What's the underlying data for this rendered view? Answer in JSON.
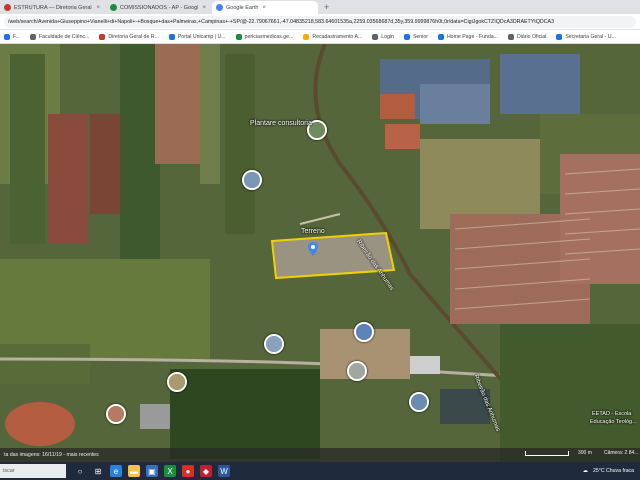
{
  "browser": {
    "tabs": [
      {
        "label": "ESTRUTURA — Diretoria Geral do...",
        "favicon_color": "#c0392b"
      },
      {
        "label": "COMISSIONADOS - AP - Googl...",
        "favicon_color": "#1e8e3e"
      },
      {
        "label": "Google Earth",
        "favicon_color": "#4285f4",
        "active": true
      }
    ],
    "new_tab": "+",
    "close": "×",
    "url": "/web/search/Avenida+Giuseppino+Vianelli+di+Napoli+-+Bosque+das+Palmeiras,+Campinas+-+SP/@-22.79067661,-47.04835218,583.64601535a,2259.03568687d,35y,359.9999876h0t,0r/data=CigiJgokCTZIQDcA3DRAETYtQDCA3",
    "bookmarks": [
      {
        "label": "F...",
        "color": "#1a73e8"
      },
      {
        "label": "Faculdade de Ciênc...",
        "color": "#5f6368"
      },
      {
        "label": "Diretoria Geral de R...",
        "color": "#c0392b"
      },
      {
        "label": "Portal Unicamp | U...",
        "color": "#1a73e8"
      },
      {
        "label": "periciasmedicas.ge...",
        "color": "#1e8e3e"
      },
      {
        "label": "Recadastramento A...",
        "color": "#f9ab00"
      },
      {
        "label": "Login",
        "color": "#5f6368"
      },
      {
        "label": "Senior",
        "color": "#1a73e8"
      },
      {
        "label": "Home Page - Funda...",
        "color": "#1a73e8"
      },
      {
        "label": "Diário Oficial",
        "color": "#5f6368"
      },
      {
        "label": "Secretaria Geral - U...",
        "color": "#1a73e8"
      }
    ]
  },
  "map": {
    "labels": {
      "parcel": "Terreno",
      "landmark": "Plantare consultoria",
      "river1": "Ribeirão das Anhumas",
      "river2": "Ribeirão das Anhumas",
      "school": "EETAD - Escola",
      "school2": "Educação Teológ..."
    },
    "status": {
      "imagery_date": "ta das imagens: 16/11/19 - mais recentes",
      "scale": "300 m",
      "camera": "Câmera: 2 84..."
    }
  },
  "taskbar": {
    "search_placeholder": "iscar",
    "weather": "25°C  Chuva fraca",
    "colors": {
      "bar": "#1f2b3c"
    }
  }
}
